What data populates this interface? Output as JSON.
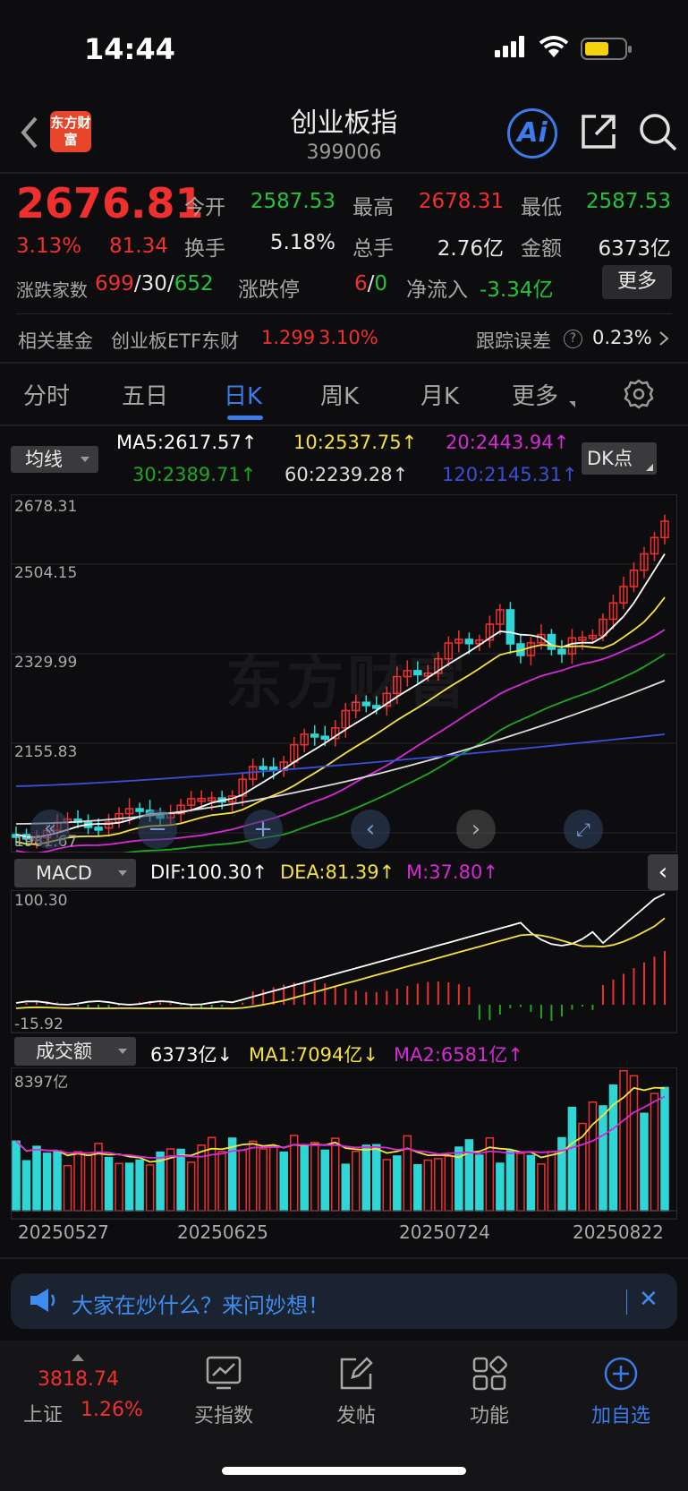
{
  "status_bar": {
    "time": "14:44"
  },
  "header": {
    "logo_text": "东方财富",
    "title": "创业板指",
    "code": "399006",
    "ai_label": "Ai"
  },
  "quote": {
    "price": "2676.81",
    "change_pct": "3.13%",
    "change": "81.34",
    "open_label": "今开",
    "open": "2587.53",
    "high_label": "最高",
    "high": "2678.31",
    "low_label": "最低",
    "low": "2587.53",
    "turnover_label": "换手",
    "turnover": "5.18%",
    "volume_label": "总手",
    "volume": "2.76亿",
    "amount_label": "金额",
    "amount": "6373亿",
    "breadth_label": "涨跌家数",
    "up": "699",
    "flat": "30",
    "down": "652",
    "limit_label": "涨跌停",
    "limit_up": "6",
    "limit_down": "0",
    "netflow_label": "净流入",
    "netflow": "-3.34亿",
    "more_label": "更多",
    "sep": "/"
  },
  "fund": {
    "label": "相关基金",
    "name": "创业板ETF东财",
    "price": "1.299",
    "pct": "3.10%",
    "tracking_label": "跟踪误差",
    "tracking_value": "0.23%"
  },
  "tabs": [
    {
      "label": "分时"
    },
    {
      "label": "五日"
    },
    {
      "label": "日K"
    },
    {
      "label": "周K"
    },
    {
      "label": "月K"
    },
    {
      "label": "更多"
    }
  ],
  "ma": {
    "selector": "均线",
    "ma5": "MA5:2617.57",
    "ma10": "10:2537.75",
    "ma20": "20:2443.94",
    "ma30": "30:2389.71",
    "ma60": "60:2239.28",
    "ma120": "120:2145.31",
    "dk_label": "DK点",
    "up_arrow": "↑",
    "down_arrow": "↓"
  },
  "kchart": {
    "y_labels": [
      "2678.31",
      "2504.15",
      "2329.99",
      "2155.83",
      "1981.67"
    ],
    "watermark": "东方财富"
  },
  "macd": {
    "selector": "MACD",
    "dif": "DIF:100.30",
    "dea": "DEA:81.39",
    "m": "M:37.80",
    "y_top": "100.30",
    "y_bottom": "-15.92"
  },
  "volume": {
    "selector": "成交额",
    "value": "6373亿",
    "ma1": "MA1:7094亿",
    "ma2": "MA2:6581亿",
    "y_top": "8397亿",
    "dates": [
      "20250527",
      "20250625",
      "20250724",
      "20250822"
    ]
  },
  "colors": {
    "up": "#f0302e",
    "down": "#2fd6d6",
    "accent": "#3b7bea",
    "ma5": "#ffffff",
    "ma10": "#f5e23c",
    "ma20": "#d62ad6",
    "ma30": "#1fa81f",
    "ma60": "#dcdcdc",
    "ma120": "#3a4fd8"
  },
  "ask_bar": {
    "text": "大家在炒什么？来问妙想！"
  },
  "bottom_nav": {
    "index_price": "3818.74",
    "index_name": "上证",
    "index_pct": "1.26%",
    "items": [
      {
        "label": "买指数"
      },
      {
        "label": "发帖"
      },
      {
        "label": "功能"
      },
      {
        "label": "加自选"
      }
    ]
  }
}
